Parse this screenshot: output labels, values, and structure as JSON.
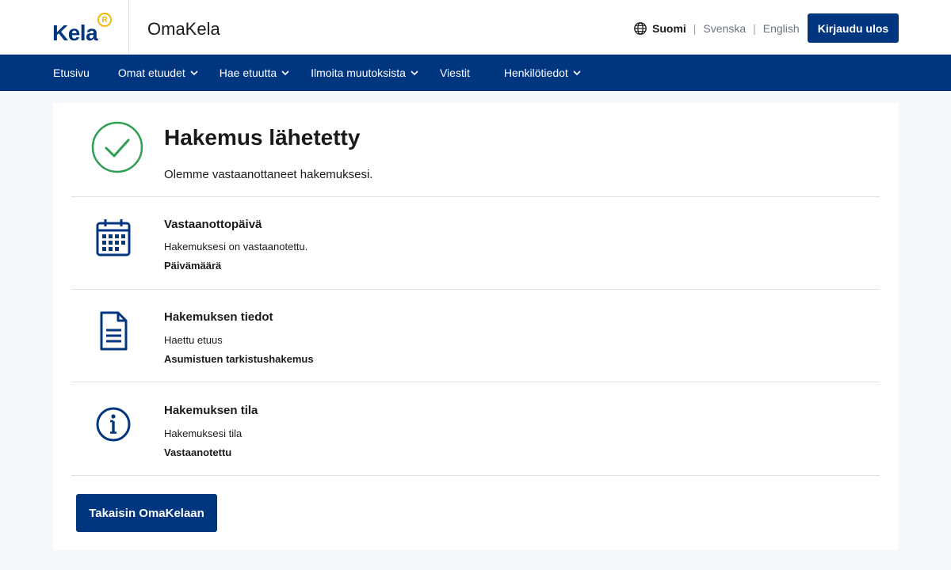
{
  "header": {
    "logo_text": "Kela",
    "logo_badge": "R",
    "app_name": "OmaKela",
    "languages": {
      "active": "Suomi",
      "others": [
        "Svenska",
        "English"
      ]
    },
    "logout_label": "Kirjaudu ulos"
  },
  "nav": {
    "items": [
      {
        "label": "Etusivu",
        "dropdown": false
      },
      {
        "label": "Omat etuudet",
        "dropdown": true
      },
      {
        "label": "Hae etuutta",
        "dropdown": true
      },
      {
        "label": "Ilmoita muutoksista",
        "dropdown": true
      },
      {
        "label": "Viestit",
        "dropdown": false
      },
      {
        "label": "Henkilötiedot",
        "dropdown": true
      }
    ]
  },
  "confirmation": {
    "icon": "check-circle-icon",
    "title": "Hakemus lähetetty",
    "subtitle": "Olemme vastaanottaneet hakemuksesi."
  },
  "sections": [
    {
      "icon": "calendar-icon",
      "title": "Vastaanottopäivä",
      "text": "Hakemuksesi on vastaanotettu.",
      "value": "Päivämäärä"
    },
    {
      "icon": "document-icon",
      "title": "Hakemuksen tiedot",
      "text": "Haettu etuus",
      "value": "Asumistuen tarkistushakemus"
    },
    {
      "icon": "info-icon",
      "title": "Hakemuksen tila",
      "text": "Hakemuksesi tila",
      "value": "Vastaanotettu"
    }
  ],
  "back_button_label": "Takaisin OmaKelaan",
  "colors": {
    "brand": "#003580",
    "success": "#2e9e52",
    "logo_accent": "#f2b705"
  }
}
